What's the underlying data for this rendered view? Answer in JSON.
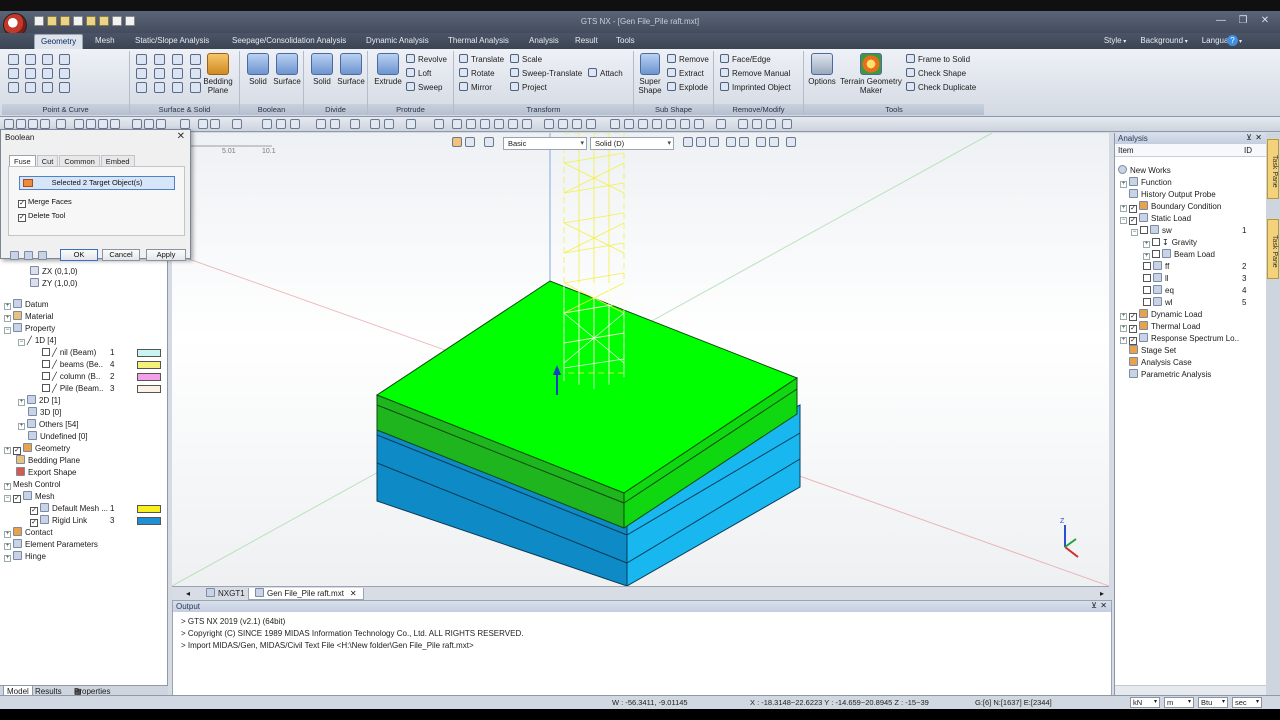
{
  "window": {
    "title": "GTS NX - [Gen File_Pile raft.mxt]"
  },
  "ribbon": {
    "tabs": [
      "Geometry",
      "Mesh",
      "Static/Slope Analysis",
      "Seepage/Consolidation Analysis",
      "Dynamic Analysis",
      "Thermal Analysis",
      "Analysis",
      "Result",
      "Tools"
    ],
    "right_menu": [
      "Style",
      "Background",
      "Language"
    ],
    "groups": {
      "point_curve": "Point & Curve",
      "surface_solid": "Surface & Solid",
      "boolean": "Boolean",
      "divide": "Divide",
      "protrude": "Protrude",
      "transform": "Transform",
      "sub_shape": "Sub Shape",
      "remove_modify": "Remove/Modify",
      "tools": "Tools"
    },
    "buttons": {
      "bedding_plane": "Bedding Plane",
      "solid": "Solid",
      "surface": "Surface",
      "divide_solid": "Solid",
      "divide_surface": "Surface",
      "extrude": "Extrude",
      "revolve": "Revolve",
      "loft": "Loft",
      "sweep": "Sweep",
      "translate": "Translate",
      "rotate": "Rotate",
      "mirror": "Mirror",
      "scale": "Scale",
      "sweep_translate": "Sweep-Translate",
      "project": "Project",
      "attach": "Attach",
      "super_shape": "Super Shape",
      "remove": "Remove",
      "extract": "Extract",
      "explode": "Explode",
      "face_edge": "Face/Edge",
      "remove_manual": "Remove Manual",
      "imprinted_object": "Imprinted Object",
      "options": "Options",
      "terrain_geometry_maker": "Terrain Geometry Maker",
      "frame_to_solid": "Frame to Solid",
      "check_shape": "Check Shape",
      "check_duplicate": "Check Duplicate"
    }
  },
  "dialog": {
    "title": "Boolean",
    "tabs": [
      "Fuse",
      "Cut",
      "Common",
      "Embed"
    ],
    "target": "Selected 2 Target Object(s)",
    "merge_faces": "Merge Faces",
    "delete_tool": "Delete Tool",
    "ok": "OK",
    "cancel": "Cancel",
    "apply": "Apply"
  },
  "left_tree": {
    "items": [
      {
        "label": "ZX (0,1,0)"
      },
      {
        "label": "ZY (1,0,0)"
      },
      {
        "label": "Datum"
      },
      {
        "label": "Material"
      },
      {
        "label": "Property"
      },
      {
        "label": "1D [4]"
      },
      {
        "label": "nil (Beam)",
        "id": "1",
        "color": "#c8f4f4"
      },
      {
        "label": "beams (Be..",
        "id": "4",
        "color": "#f5f07a"
      },
      {
        "label": "column (B..",
        "id": "2",
        "color": "#f2a0e8"
      },
      {
        "label": "Pile (Beam..",
        "id": "3",
        "color": "#fbf4e6"
      },
      {
        "label": "2D [1]"
      },
      {
        "label": "3D [0]"
      },
      {
        "label": "Others [54]"
      },
      {
        "label": "Undefined [0]"
      },
      {
        "label": "Geometry"
      },
      {
        "label": "Bedding Plane"
      },
      {
        "label": "Export Shape"
      },
      {
        "label": "Mesh Control"
      },
      {
        "label": "Mesh"
      },
      {
        "label": "Default Mesh ...",
        "id": "1",
        "color": "#f5f01e"
      },
      {
        "label": "Rigid Link",
        "id": "3",
        "color": "#1f8fd6"
      },
      {
        "label": "Contact"
      },
      {
        "label": "Element Parameters"
      },
      {
        "label": "Hinge"
      }
    ],
    "bottom_tabs": [
      "Model",
      "Results",
      "Properties"
    ]
  },
  "viewport": {
    "view_mode": "Basic",
    "display_mode": "Solid (D)",
    "ruler_labels": [
      "5.01",
      "10.1"
    ],
    "colors": {
      "raft_top": "#00ff00",
      "soil": "#0ba3e6",
      "pile_grid": "#f3f048",
      "background": "#f5f7f9"
    }
  },
  "doc_tabs": [
    "NXGT1",
    "Gen File_Pile raft.mxt"
  ],
  "output": {
    "title": "Output",
    "lines": [
      "> GTS NX 2019 (v2.1) (64bit)",
      "> Copyright (C) SINCE 1989 MIDAS Information Technology Co., Ltd. ALL RIGHTS RESERVED.",
      "> Import MIDAS/Gen, MIDAS/Civil Text File <H:\\New folder\\Gen File_Pile raft.mxt>"
    ]
  },
  "analysis_panel": {
    "title": "Analysis",
    "header_item": "Item",
    "header_id": "ID",
    "items": [
      {
        "label": "New Works"
      },
      {
        "label": "Function"
      },
      {
        "label": "History Output Probe"
      },
      {
        "label": "Boundary Condition"
      },
      {
        "label": "Static Load"
      },
      {
        "label": "sw",
        "id": "1"
      },
      {
        "label": "Gravity"
      },
      {
        "label": "Beam Load"
      },
      {
        "label": "ff",
        "id": "2"
      },
      {
        "label": "ll",
        "id": "3"
      },
      {
        "label": "eq",
        "id": "4"
      },
      {
        "label": "wl",
        "id": "5"
      },
      {
        "label": "Dynamic Load"
      },
      {
        "label": "Thermal Load"
      },
      {
        "label": "Response Spectrum Lo.."
      },
      {
        "label": "Stage Set"
      },
      {
        "label": "Analysis Case"
      },
      {
        "label": "Parametric Analysis"
      }
    ]
  },
  "task_pane": [
    "Task Pane",
    "Task Pane"
  ],
  "status": {
    "w": "W : -56.3411, -9.01145",
    "xyz": "X : -18.3148~22.6223  Y : -14.659~20.8945  Z : -15~39",
    "counts": "G:[6]  N:[1637]  E:[2344]",
    "units": [
      "kN",
      "m",
      "Btu",
      "sec"
    ]
  }
}
